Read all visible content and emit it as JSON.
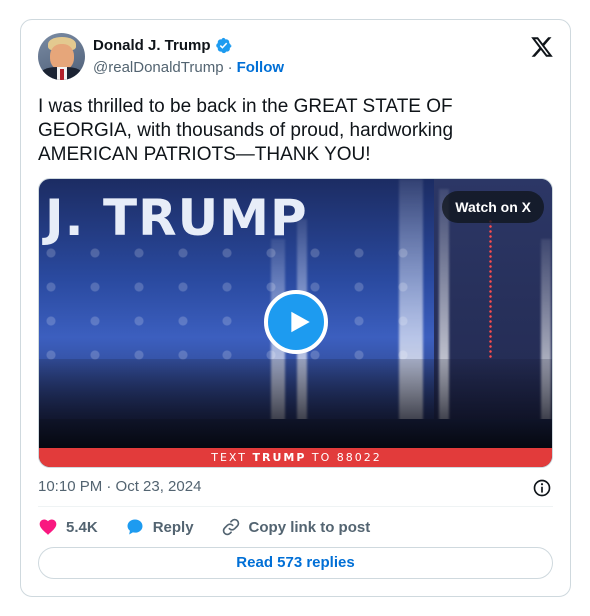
{
  "author": {
    "display_name": "Donald J. Trump",
    "handle": "@realDonaldTrump",
    "separator": "·",
    "follow_label": "Follow"
  },
  "tweet": {
    "text": "I was thrilled to be back in the GREAT STATE OF GEORGIA, with thousands of proud, hardworking AMERICAN PATRIOTS—THANK YOU!",
    "timestamp": "10:10 PM · Oct 23, 2024"
  },
  "media": {
    "stage_text": "J. TRUMP",
    "watch_label": "Watch on X",
    "banner_prefix": "TEXT ",
    "banner_bold": "TRUMP",
    "banner_suffix": " TO 88022"
  },
  "actions": {
    "likes": "5.4K",
    "reply_label": "Reply",
    "copy_link_label": "Copy link to post"
  },
  "footer": {
    "read_replies_label": "Read 573 replies"
  },
  "colors": {
    "brand_blue": "#1d9bf0",
    "link_blue": "#006fd6",
    "like_pink": "#f91880",
    "banner_red": "#e23b3b",
    "muted_text": "#536471"
  },
  "icons": [
    "verified-badge-icon",
    "x-logo-icon",
    "play-icon",
    "info-icon",
    "heart-icon",
    "reply-icon",
    "link-icon"
  ]
}
